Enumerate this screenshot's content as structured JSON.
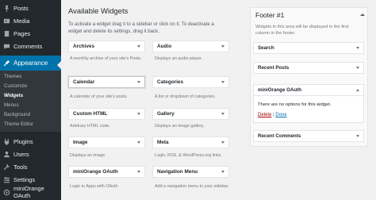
{
  "admin_menu": {
    "items": [
      {
        "label": "Posts",
        "icon": "pin-icon"
      },
      {
        "label": "Media",
        "icon": "media-icon"
      },
      {
        "label": "Pages",
        "icon": "page-icon"
      },
      {
        "label": "Comments",
        "icon": "comment-icon"
      },
      {
        "label": "Appearance",
        "icon": "brush-icon"
      },
      {
        "label": "Plugins",
        "icon": "plugin-icon"
      },
      {
        "label": "Users",
        "icon": "user-icon"
      },
      {
        "label": "Tools",
        "icon": "wrench-icon"
      },
      {
        "label": "Settings",
        "icon": "settings-icon"
      },
      {
        "label": "miniOrange OAuth",
        "icon": "mo-icon"
      }
    ],
    "submenu": [
      "Themes",
      "Customize",
      "Widgets",
      "Menus",
      "Background",
      "Theme Editor"
    ],
    "colors": {
      "bg": "#23282d",
      "current": "#0073aa",
      "submenu_bg": "#32373c"
    }
  },
  "available": {
    "title": "Available Widgets",
    "description": "To activate a widget drag it to a sidebar or click on it. To deactivate a widget and delete its settings, drag it back.",
    "widgets": [
      {
        "name": "Archives",
        "desc": "A monthly archive of your site's Posts."
      },
      {
        "name": "Audio",
        "desc": "Displays an audio player."
      },
      {
        "name": "Calendar",
        "desc": "A calendar of your site's posts."
      },
      {
        "name": "Categories",
        "desc": "A list or dropdown of categories."
      },
      {
        "name": "Custom HTML",
        "desc": "Arbitrary HTML code."
      },
      {
        "name": "Gallery",
        "desc": "Displays an image gallery."
      },
      {
        "name": "Image",
        "desc": "Displays an image."
      },
      {
        "name": "Meta",
        "desc": "Login, RSS, & WordPress.org links."
      },
      {
        "name": "miniOrange OAuth",
        "desc": "Login to Apps with OAuth"
      },
      {
        "name": "Navigation Menu",
        "desc": "Add a navigation menu to your sidebar."
      }
    ]
  },
  "sidebar": {
    "title": "Footer #1",
    "description": "Widgets in this area will be displayed in the first column in the footer.",
    "widgets": [
      "Search",
      "Recent Posts",
      "miniOrange OAuth",
      "Recent Comments"
    ],
    "open_widget": {
      "message": "There are no options for this widget.",
      "delete_label": "Delete",
      "separator": "|",
      "done_label": "Done"
    }
  }
}
